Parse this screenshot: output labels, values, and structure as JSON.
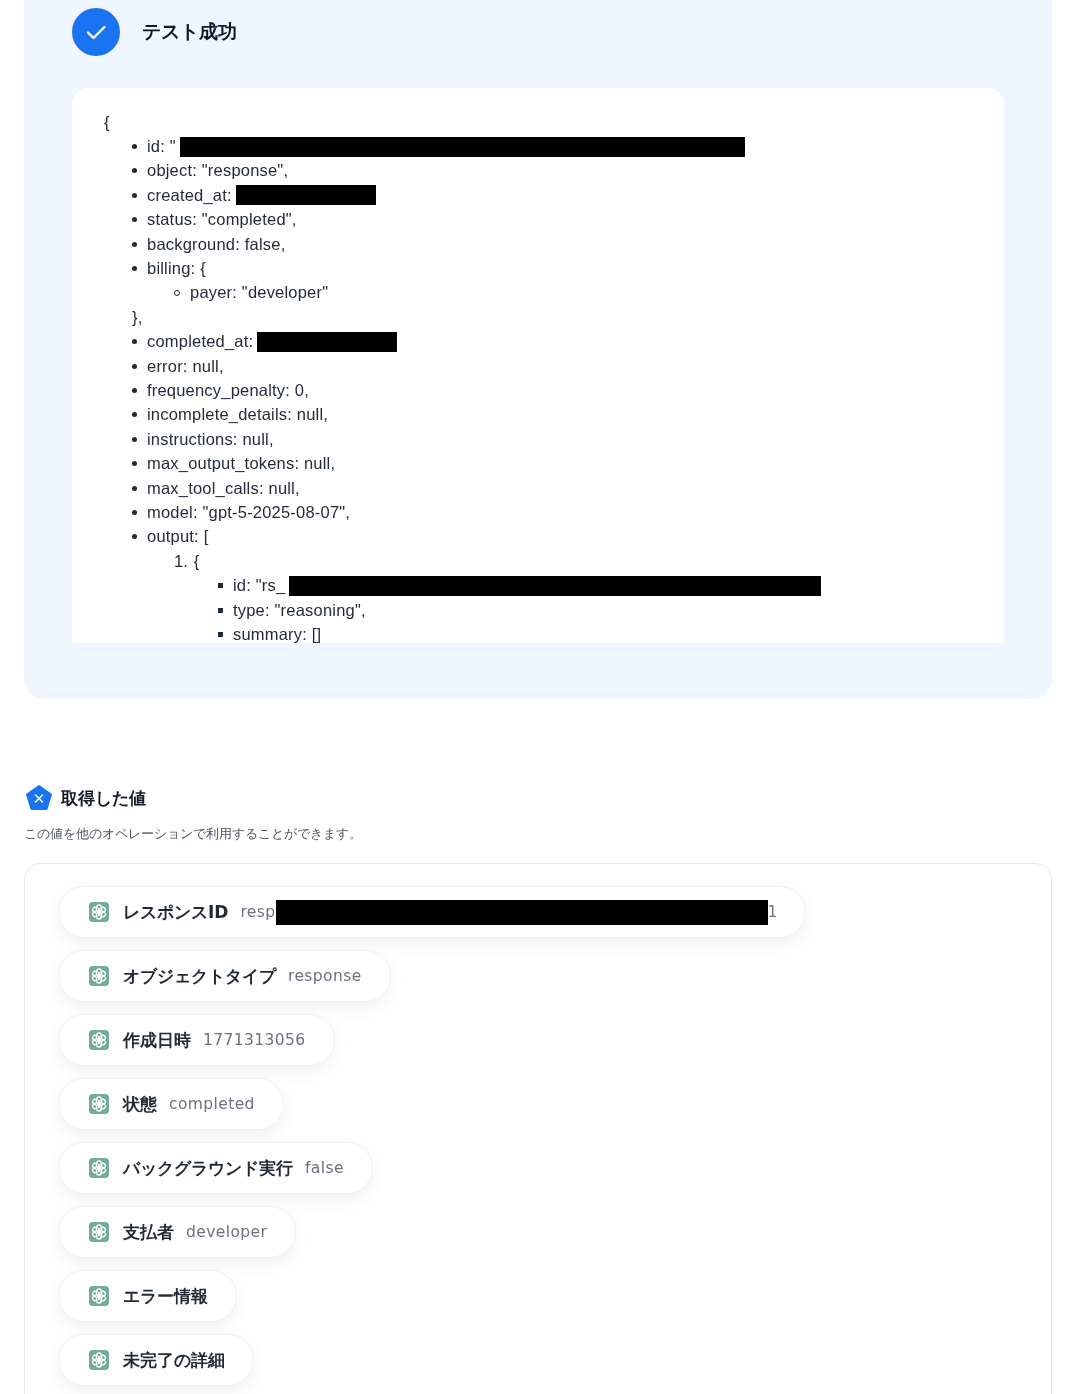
{
  "test_result": {
    "title": "テスト成功",
    "success": true,
    "lines": [
      {
        "kind": "plain",
        "text": "{",
        "children": [
          {
            "kind": "disc",
            "text": "id: \"",
            "redacted": true,
            "wide": true
          },
          {
            "kind": "disc",
            "text": "object: \"response\","
          },
          {
            "kind": "disc",
            "text": "created_at:",
            "redacted": true,
            "wide": false
          },
          {
            "kind": "disc",
            "text": "status: \"completed\","
          },
          {
            "kind": "disc",
            "text": "background: false,"
          },
          {
            "kind": "disc",
            "text": "billing: {",
            "close": "},",
            "children": [
              {
                "kind": "circle",
                "text": "payer: \"developer\""
              }
            ]
          },
          {
            "kind": "disc",
            "text": "completed_at:",
            "redacted": true,
            "wide": false
          },
          {
            "kind": "disc",
            "text": "error: null,"
          },
          {
            "kind": "disc",
            "text": "frequency_penalty: 0,"
          },
          {
            "kind": "disc",
            "text": "incomplete_details: null,"
          },
          {
            "kind": "disc",
            "text": "instructions: null,"
          },
          {
            "kind": "disc",
            "text": "max_output_tokens: null,"
          },
          {
            "kind": "disc",
            "text": "max_tool_calls: null,"
          },
          {
            "kind": "disc",
            "text": "model: \"gpt-5-2025-08-07\","
          },
          {
            "kind": "disc",
            "text": "output: [",
            "children": [
              {
                "kind": "numbered",
                "marker": "1.",
                "text": "{",
                "children": [
                  {
                    "kind": "square",
                    "text": "id: \"rs_",
                    "redacted": true,
                    "wide": true
                  },
                  {
                    "kind": "square",
                    "text": "type: \"reasoning\","
                  },
                  {
                    "kind": "square",
                    "text": "summary: []"
                  }
                ]
              }
            ]
          }
        ]
      }
    ]
  },
  "acquired_values": {
    "title": "取得した値",
    "description": "この値を他のオペレーションで利用することができます。",
    "items": [
      {
        "label": "レスポンスID",
        "value": "resp",
        "redacted": true,
        "value_end": "1"
      },
      {
        "label": "オブジェクトタイプ",
        "value": "response"
      },
      {
        "label": "作成日時",
        "value": "1771313056"
      },
      {
        "label": "状態",
        "value": "completed"
      },
      {
        "label": "バックグラウンド実行",
        "value": "false"
      },
      {
        "label": "支払者",
        "value": "developer"
      },
      {
        "label": "エラー情報"
      },
      {
        "label": "未完了の詳細"
      }
    ]
  }
}
